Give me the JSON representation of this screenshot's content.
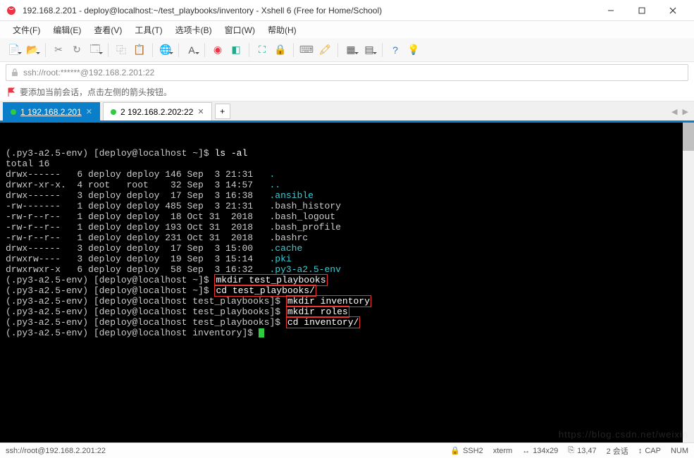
{
  "window": {
    "title": "192.168.2.201 - deploy@localhost:~/test_playbooks/inventory - Xshell 6 (Free for Home/School)"
  },
  "menu": {
    "items": [
      "文件(F)",
      "编辑(E)",
      "查看(V)",
      "工具(T)",
      "选项卡(B)",
      "窗口(W)",
      "帮助(H)"
    ]
  },
  "toolbar": {
    "icons": [
      {
        "name": "new-session-icon",
        "drop": true,
        "color": "#2a8",
        "glyph": "📄"
      },
      {
        "name": "open-folder-icon",
        "drop": true,
        "color": "#d90",
        "glyph": "📂"
      },
      {
        "sep": true
      },
      {
        "name": "cut-icon",
        "color": "#888",
        "glyph": "✂"
      },
      {
        "name": "reconnect-icon",
        "color": "#888",
        "glyph": "↻"
      },
      {
        "name": "properties-icon",
        "drop": true,
        "color": "#888",
        "glyph": "🗔"
      },
      {
        "sep": true
      },
      {
        "name": "copy-icon",
        "color": "#888",
        "glyph": "⿻"
      },
      {
        "name": "paste-icon",
        "color": "#888",
        "glyph": "📋"
      },
      {
        "sep": true
      },
      {
        "name": "globe-icon",
        "drop": true,
        "color": "#2b7bd6",
        "glyph": "🌐"
      },
      {
        "sep": true
      },
      {
        "name": "font-icon",
        "drop": true,
        "color": "#555",
        "glyph": "A"
      },
      {
        "sep": true
      },
      {
        "name": "app-icon",
        "color": "#e34",
        "glyph": "◉"
      },
      {
        "name": "xftp-icon",
        "color": "#2a8",
        "glyph": "◧"
      },
      {
        "sep": true
      },
      {
        "name": "fullscreen-icon",
        "color": "#2a8",
        "glyph": "⛶"
      },
      {
        "name": "lock-icon",
        "color": "#d90",
        "glyph": "🔒"
      },
      {
        "sep": true
      },
      {
        "name": "keyboard-icon",
        "color": "#888",
        "glyph": "⌨"
      },
      {
        "name": "highlight-icon",
        "color": "#d90",
        "glyph": "🖍"
      },
      {
        "sep": true
      },
      {
        "name": "layout-icon",
        "drop": true,
        "color": "#555",
        "glyph": "▦"
      },
      {
        "name": "tile-icon",
        "drop": true,
        "color": "#555",
        "glyph": "▤"
      },
      {
        "sep": true
      },
      {
        "name": "help-icon",
        "color": "#2b7bd6",
        "glyph": "?"
      },
      {
        "name": "lightbulb-icon",
        "color": "#aaa",
        "glyph": "💡"
      }
    ]
  },
  "address": {
    "value": "ssh://root:******@192.168.2.201:22"
  },
  "hint": {
    "text": "要添加当前会话，点击左侧的箭头按钮。"
  },
  "tabs": {
    "items": [
      {
        "index": "1",
        "label": "192.168.2.201",
        "active": true
      },
      {
        "index": "2",
        "label": "192.168.2.202:22",
        "active": false
      }
    ]
  },
  "terminal": {
    "prompt_env": "(.py3-a2.5-env)",
    "lines": [
      {
        "type": "cmd",
        "prompt": "[deploy@localhost ~]$",
        "boxed": false,
        "cmd": "ls -al"
      },
      {
        "type": "plain",
        "text": "total 16"
      },
      {
        "type": "ls",
        "perms": "drwx------",
        "n": "6",
        "u": "deploy",
        "g": "deploy",
        "size": "146",
        "date": "Sep  3 21:31",
        "name": ".",
        "dir": true
      },
      {
        "type": "ls",
        "perms": "drwxr-xr-x.",
        "n": "4",
        "u": "root",
        "g": "root",
        "size": " 32",
        "date": "Sep  3 14:57",
        "name": "..",
        "dir": true
      },
      {
        "type": "ls",
        "perms": "drwx------",
        "n": "3",
        "u": "deploy",
        "g": "deploy",
        "size": " 17",
        "date": "Sep  3 16:38",
        "name": ".ansible",
        "dir": true
      },
      {
        "type": "ls",
        "perms": "-rw-------",
        "n": "1",
        "u": "deploy",
        "g": "deploy",
        "size": "485",
        "date": "Sep  3 21:31",
        "name": ".bash_history",
        "dir": false
      },
      {
        "type": "ls",
        "perms": "-rw-r--r--",
        "n": "1",
        "u": "deploy",
        "g": "deploy",
        "size": " 18",
        "date": "Oct 31  2018",
        "name": ".bash_logout",
        "dir": false
      },
      {
        "type": "ls",
        "perms": "-rw-r--r--",
        "n": "1",
        "u": "deploy",
        "g": "deploy",
        "size": "193",
        "date": "Oct 31  2018",
        "name": ".bash_profile",
        "dir": false
      },
      {
        "type": "ls",
        "perms": "-rw-r--r--",
        "n": "1",
        "u": "deploy",
        "g": "deploy",
        "size": "231",
        "date": "Oct 31  2018",
        "name": ".bashrc",
        "dir": false
      },
      {
        "type": "ls",
        "perms": "drwx------",
        "n": "3",
        "u": "deploy",
        "g": "deploy",
        "size": " 17",
        "date": "Sep  3 15:00",
        "name": ".cache",
        "dir": true
      },
      {
        "type": "ls",
        "perms": "drwxrw----",
        "n": "3",
        "u": "deploy",
        "g": "deploy",
        "size": " 19",
        "date": "Sep  3 15:14",
        "name": ".pki",
        "dir": true
      },
      {
        "type": "ls",
        "perms": "drwxrwxr-x",
        "n": "6",
        "u": "deploy",
        "g": "deploy",
        "size": " 58",
        "date": "Sep  3 16:32",
        "name": ".py3-a2.5-env",
        "dir": true
      },
      {
        "type": "cmd",
        "prompt": "[deploy@localhost ~]$",
        "boxed": true,
        "cmd": "mkdir test_playbooks"
      },
      {
        "type": "cmd",
        "prompt": "[deploy@localhost ~]$",
        "boxed": true,
        "cmd": "cd test_playbooks/"
      },
      {
        "type": "cmd",
        "prompt": "[deploy@localhost test_playbooks]$",
        "boxed": true,
        "cmd": "mkdir inventory"
      },
      {
        "type": "cmd",
        "prompt": "[deploy@localhost test_playbooks]$",
        "boxed": true,
        "cmd": "mkdir roles"
      },
      {
        "type": "cmd",
        "prompt": "[deploy@localhost test_playbooks]$",
        "boxed": true,
        "cmd": "cd inventory/"
      },
      {
        "type": "cmd",
        "prompt": "[deploy@localhost inventory]$",
        "boxed": false,
        "cmd": "",
        "cursor": true
      }
    ]
  },
  "status": {
    "left": "ssh://root@192.168.2.201:22",
    "proto_icon": "🔒",
    "proto": "SSH2",
    "term": "xterm",
    "size_icon": "↔",
    "size": "134x29",
    "pos_icon": "⎘",
    "pos": "13,47",
    "sess": "2 会话",
    "caps_icon": "↕",
    "cap": "CAP",
    "num": "NUM"
  },
  "watermark": "https://blog.csdn.net/weixin"
}
